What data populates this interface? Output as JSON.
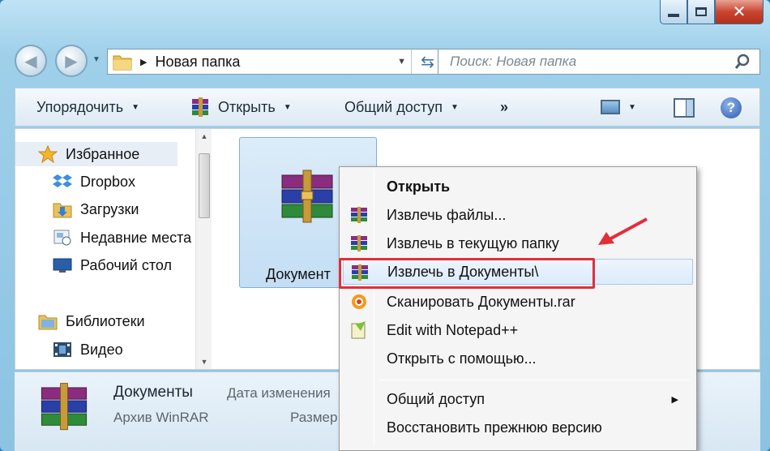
{
  "window": {
    "caption": {
      "minimize": "minimize",
      "maximize": "maximize",
      "close": "✕"
    }
  },
  "nav": {
    "back_icon": "◀",
    "forward_icon": "▶",
    "address": {
      "crumb": "Новая папка"
    },
    "search": {
      "placeholder": "Поиск: Новая папка"
    }
  },
  "toolbar": {
    "organize": "Упорядочить",
    "open": "Открыть",
    "share": "Общий доступ",
    "more": "»",
    "help": "?"
  },
  "sidebar": {
    "items": [
      {
        "label": "Избранное",
        "icon": "star-icon"
      },
      {
        "label": "Dropbox",
        "icon": "dropbox-icon"
      },
      {
        "label": "Загрузки",
        "icon": "downloads-folder-icon"
      },
      {
        "label": "Недавние места",
        "icon": "recent-places-icon"
      },
      {
        "label": "Рабочий стол",
        "icon": "desktop-icon"
      },
      {
        "label": "Библиотеки",
        "icon": "libraries-icon"
      },
      {
        "label": "Видео",
        "icon": "video-icon"
      }
    ]
  },
  "file": {
    "name": "Документ"
  },
  "context_menu": {
    "items": [
      {
        "label": "Открыть"
      },
      {
        "label": "Извлечь файлы..."
      },
      {
        "label": "Извлечь в текущую папку"
      },
      {
        "label": "Извлечь в Документы\\"
      },
      {
        "label": "Сканировать Документы.rar"
      },
      {
        "label": "Edit with Notepad++"
      },
      {
        "label": "Открыть с помощью..."
      },
      {
        "label": "Общий доступ"
      },
      {
        "label": "Восстановить прежнюю версию"
      }
    ]
  },
  "details": {
    "name": "Документы",
    "type": "Архив WinRAR",
    "date_label": "Дата изменения",
    "size_label": "Размер"
  },
  "colors": {
    "highlight": "#e12f3a",
    "window": "#8cc3e2"
  }
}
